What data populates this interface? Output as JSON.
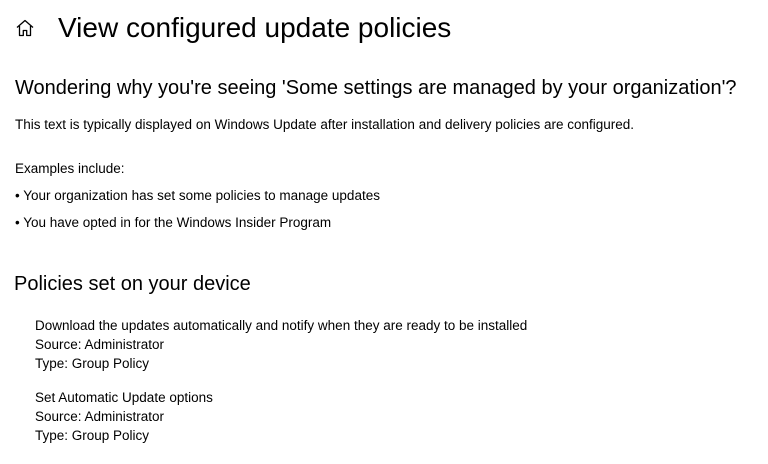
{
  "header": {
    "home_icon": "home-icon",
    "title": "View configured update policies"
  },
  "info": {
    "heading": "Wondering why you're seeing 'Some settings are managed by your organization'?",
    "description": "This text is typically displayed on Windows Update after installation and delivery policies are configured.",
    "examples_label": "Examples include:",
    "examples": [
      "• Your organization has set some policies to manage updates",
      "• You have opted in for the Windows Insider Program"
    ]
  },
  "policies": {
    "heading": "Policies set on your device",
    "items": [
      {
        "name": "Download the updates automatically and notify when they are ready to be installed",
        "source": "Source: Administrator",
        "type": "Type: Group Policy"
      },
      {
        "name": "Set Automatic Update options",
        "source": "Source: Administrator",
        "type": "Type: Group Policy"
      }
    ]
  }
}
